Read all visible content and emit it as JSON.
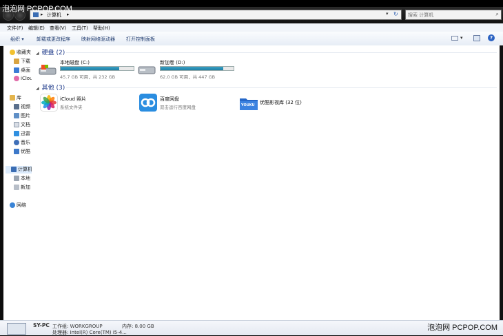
{
  "watermark": {
    "top_left": "泡泡网 PCPOP.COM",
    "bottom_right": "泡泡网 PCPOP.COM"
  },
  "address": {
    "crumb_root_icon": "computer-icon",
    "crumb": "计算机",
    "crumb_sep": "▸",
    "refresh": "↻"
  },
  "search": {
    "placeholder": "搜索 计算机"
  },
  "menu": [
    "文件(F)",
    "编辑(E)",
    "查看(V)",
    "工具(T)",
    "帮助(H)"
  ],
  "toolbar": {
    "organize": "组织 ▾",
    "uninstall": "卸载或更改程序",
    "map_drive": "映射网络驱动器",
    "control_panel": "打开控制面板"
  },
  "sidebar": {
    "favorites": "收藏夹",
    "downloads": "下载",
    "desktop": "桌面",
    "icloud": "iCloud",
    "library": "库",
    "video": "视频",
    "pictures": "图片",
    "documents": "文档",
    "thunder": "迅雷",
    "music": "音乐",
    "youku": "优酷",
    "computer": "计算机",
    "local_disk": "本地",
    "new_volume": "新加",
    "network": "网络"
  },
  "groups": {
    "disks": "硬盘 (2)",
    "others": "其他 (3)",
    "collapse_glyph": "◢"
  },
  "drives": [
    {
      "name": "本地磁盘 (C:)",
      "free": "45.7 GB 可用，共 232 GB",
      "used_fraction": 0.8
    },
    {
      "name": "新加卷 (D:)",
      "free": "62.0 GB 可用，共 447 GB",
      "used_fraction": 0.86
    }
  ],
  "others": [
    {
      "name": "iCloud 照片",
      "sub": "系统文件夹"
    },
    {
      "name": "百度网盘",
      "sub": "双击运行百度网盘"
    },
    {
      "name": "优酷影视库 (32 位)",
      "sub": "",
      "logo_text": "YOUKU"
    }
  ],
  "status": {
    "pc_name": "SY-PC",
    "workgroup": "工作组: WORKGROUP",
    "memory": "内存: 8.00 GB",
    "cpu": "处理器: Intel(R) Core(TM) i5-4..."
  },
  "colors": {
    "accent": "#1e3a8a",
    "bar_fill": "#1f7fa6",
    "baidu": "#2a8de0",
    "youku": "#2567c8"
  }
}
